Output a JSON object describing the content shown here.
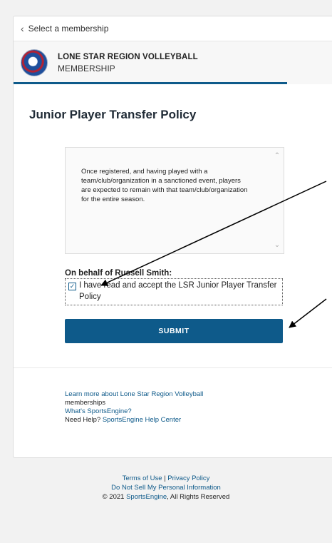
{
  "back_link": "Select a membership",
  "org": {
    "name": "LONE STAR REGION VOLLEYBALL",
    "subtitle": "MEMBERSHIP"
  },
  "policy": {
    "title": "Junior Player Transfer Policy",
    "text": "Once registered, and having played with a team/club/organization in a sanctioned event, players are expected to remain with that team/club/organization for the entire season."
  },
  "form": {
    "behalf_label": "On behalf of Russell Smith:",
    "accept_label": "I have read and accept the LSR Junior Player Transfer Policy",
    "accept_checked": true,
    "submit_label": "SUBMIT"
  },
  "links": {
    "learn_more": "Learn more about Lone Star Region Volleyball",
    "learn_more_suffix": "memberships",
    "whats_sportsengine": "What's SportsEngine?",
    "need_help_prefix": "Need Help?",
    "help_center": "SportsEngine Help Center"
  },
  "footer": {
    "terms": "Terms of Use",
    "separator": "|",
    "privacy": "Privacy Policy",
    "do_not_sell": "Do Not Sell My Personal Information",
    "copyright_prefix": "© 2021",
    "sportsengine": "SportsEngine",
    "copyright_suffix": ", All Rights Reserved"
  },
  "colors": {
    "accent": "#0e5a8a",
    "page_bg": "#f2f2f2",
    "arrow": "#000000"
  },
  "icons": {
    "back": "chevron-left-icon",
    "scroll_up": "chevron-up-icon",
    "scroll_down": "chevron-down-icon",
    "checkbox": "checkmark-icon"
  }
}
